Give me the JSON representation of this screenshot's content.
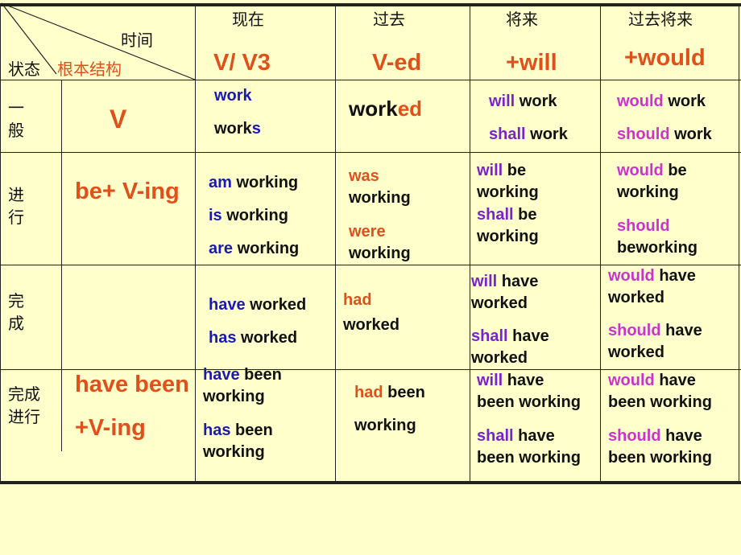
{
  "corner": {
    "time_label": "时间",
    "state_label": "状态",
    "structure_label": "根本结构"
  },
  "columns": [
    {
      "cn": "现在",
      "formula": "V/ V3"
    },
    {
      "cn": "过去",
      "formula": "V-ed"
    },
    {
      "cn": "将来",
      "formula": "+will"
    },
    {
      "cn": "过去将来",
      "formula": "+would"
    }
  ],
  "rows": [
    {
      "label": "一\n般",
      "structure": "V",
      "present": [
        [
          "work",
          ""
        ],
        [
          "work",
          "s"
        ]
      ],
      "past": [
        [
          "work",
          "ed"
        ]
      ],
      "future": [
        [
          "will",
          " work"
        ],
        [
          "shall",
          " work"
        ]
      ],
      "past_future": [
        [
          "would",
          " work"
        ],
        [
          "should",
          " work"
        ]
      ]
    },
    {
      "label": "进\n行",
      "structure": "be+ V-ing",
      "present": [
        [
          "am",
          " working"
        ],
        [
          "is",
          " working"
        ],
        [
          "are",
          " working"
        ]
      ],
      "past": [
        [
          "was",
          ""
        ],
        [
          "",
          "working"
        ],
        [
          "were",
          ""
        ],
        [
          "",
          "working"
        ]
      ],
      "future": [
        [
          "will",
          " be"
        ],
        [
          "",
          "working"
        ],
        [
          "shall",
          " be"
        ],
        [
          "",
          "working"
        ]
      ],
      "past_future": [
        [
          "would",
          " be"
        ],
        [
          "",
          "working"
        ],
        [
          "should",
          ""
        ],
        [
          "",
          "beworking"
        ]
      ]
    },
    {
      "label": "完\n成",
      "structure": "",
      "present": [
        [
          "have",
          " worked"
        ],
        [
          "has",
          " worked"
        ]
      ],
      "past": [
        [
          "had",
          ""
        ],
        [
          "",
          "worked"
        ]
      ],
      "future": [
        [
          "will",
          " have"
        ],
        [
          "",
          "worked"
        ],
        [
          "shall",
          " have"
        ],
        [
          "",
          "worked"
        ]
      ],
      "past_future": [
        [
          "would",
          " have"
        ],
        [
          "",
          "worked"
        ],
        [
          "should",
          " have"
        ],
        [
          "",
          "worked"
        ]
      ]
    },
    {
      "label": "完成\n进行",
      "structure_line1": "have been",
      "structure_line2": "+V-ing",
      "present": [
        [
          "have",
          " been"
        ],
        [
          "",
          "working"
        ],
        [
          "has",
          " been"
        ],
        [
          "",
          "working"
        ]
      ],
      "past": [
        [
          "had",
          " been"
        ],
        [
          "",
          "working"
        ]
      ],
      "future": [
        [
          "will",
          " have"
        ],
        [
          "",
          "been working"
        ],
        [
          "shall",
          " have"
        ],
        [
          "",
          "been working"
        ]
      ],
      "past_future": [
        [
          "would",
          " have"
        ],
        [
          "",
          "been working"
        ],
        [
          "should",
          " have"
        ],
        [
          "",
          "been working"
        ]
      ]
    }
  ],
  "colors": {
    "background": "#FFFFCC",
    "formula_orange": "#E0501A",
    "present_blue": "#1A1AB0",
    "future_purple": "#7A22CC",
    "past_future_magenta": "#CC33CC"
  }
}
